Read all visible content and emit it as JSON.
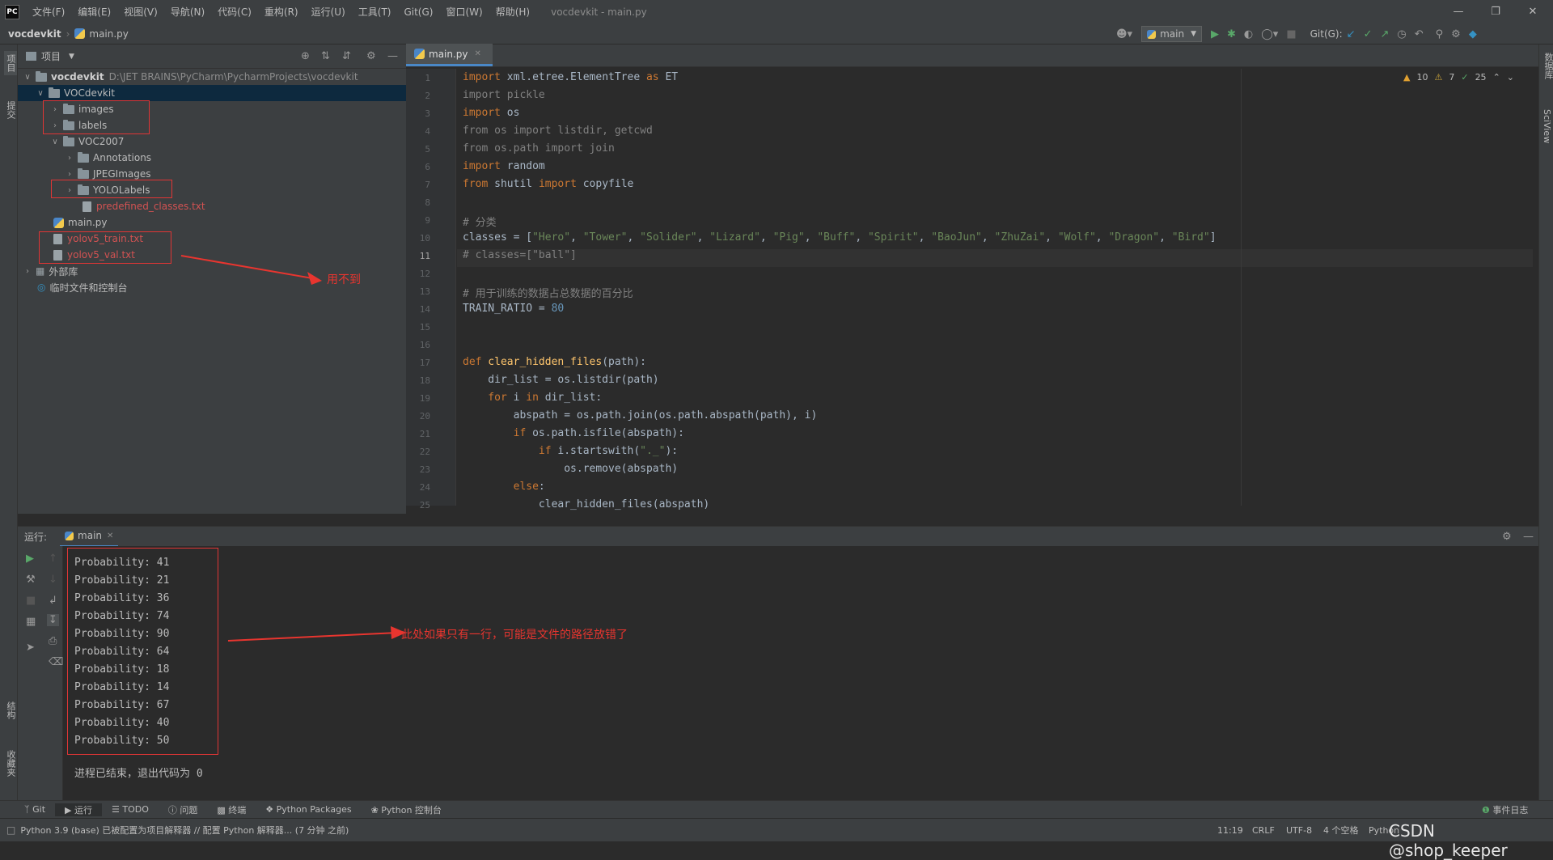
{
  "titlebar": {
    "logo": "PC",
    "menus": [
      "文件(F)",
      "编辑(E)",
      "视图(V)",
      "导航(N)",
      "代码(C)",
      "重构(R)",
      "运行(U)",
      "工具(T)",
      "Git(G)",
      "窗口(W)",
      "帮助(H)"
    ],
    "title": "vocdevkit - main.py"
  },
  "navbar": {
    "breadcrumb_project": "vocdevkit",
    "breadcrumb_file": "main.py",
    "run_config": "main",
    "git_label": "Git(G):"
  },
  "left_strip": {
    "project": "项目",
    "commit": "提交",
    "structure": "结构",
    "favorites": "收藏夹"
  },
  "right_strip": {
    "database": "数据库",
    "sciview": "SciView"
  },
  "project_panel": {
    "title": "项目",
    "tree": [
      {
        "name": "vocdevkit",
        "path": "D:\\JET BRAINS\\PyCharm\\PycharmProjects\\vocdevkit"
      },
      {
        "name": "VOCdevkit"
      },
      {
        "name": "images"
      },
      {
        "name": "labels"
      },
      {
        "name": "VOC2007"
      },
      {
        "name": "Annotations"
      },
      {
        "name": "JPEGImages"
      },
      {
        "name": "YOLOLabels"
      },
      {
        "name": "predefined_classes.txt"
      },
      {
        "name": "main.py"
      },
      {
        "name": "yolov5_train.txt"
      },
      {
        "name": "yolov5_val.txt"
      },
      {
        "name": "外部库"
      },
      {
        "name": "临时文件和控制台"
      }
    ]
  },
  "annotations": {
    "unused": "用不到",
    "path_hint": "此处如果只有一行，可能是文件的路径放错了"
  },
  "editor": {
    "tab": "main.py",
    "inspections": {
      "errors": "10",
      "warnings": "7",
      "ok": "25"
    },
    "current_line": "11",
    "line_numbers": [
      "1",
      "2",
      "3",
      "4",
      "5",
      "6",
      "7",
      "8",
      "9",
      "10",
      "11",
      "12",
      "13",
      "14",
      "15",
      "16",
      "17",
      "18",
      "19",
      "20",
      "21",
      "22",
      "23",
      "24",
      "25"
    ]
  },
  "run": {
    "label": "运行:",
    "tab": "main",
    "output": [
      "Probability: 41",
      "Probability: 21",
      "Probability: 36",
      "Probability: 74",
      "Probability: 90",
      "Probability: 64",
      "Probability: 18",
      "Probability: 14",
      "Probability: 67",
      "Probability: 40",
      "Probability: 50"
    ],
    "exit_message": "进程已结束，退出代码为 0"
  },
  "bottom_tabs": [
    "Git",
    "运行",
    "TODO",
    "问题",
    "终端",
    "Python Packages",
    "Python 控制台"
  ],
  "event_log": "事件日志",
  "status": {
    "message": "Python 3.9 (base) 已被配置为项目解释器 // 配置 Python 解释器... (7 分钟 之前)",
    "position": "11:19",
    "line_sep": "CRLF",
    "encoding": "UTF-8",
    "indent": "4 个空格",
    "interpreter": "Python"
  },
  "watermark": "CSDN @shop_keeper",
  "colors": {
    "keyword": "#cc7832",
    "string": "#6a8759",
    "comment": "#808080",
    "number": "#6897bb",
    "function": "#ffc66d",
    "annotation": "#e8352f"
  }
}
